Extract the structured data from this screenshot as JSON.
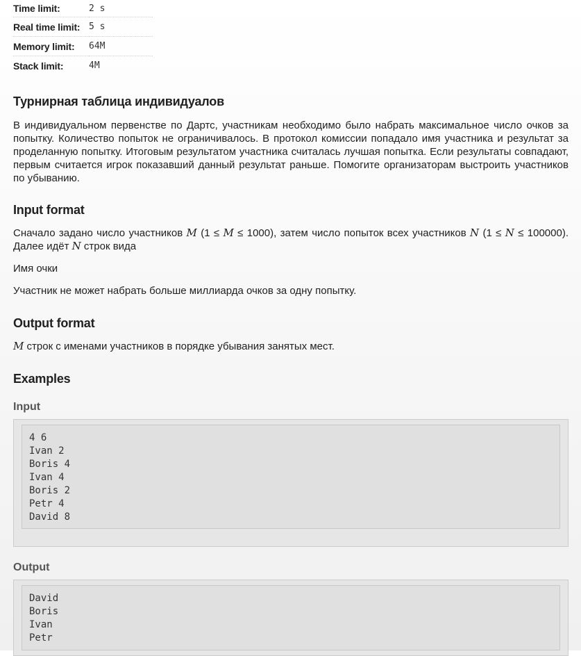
{
  "limits": [
    {
      "label": "Time limit:",
      "value": "2 s"
    },
    {
      "label": "Real time limit:",
      "value": "5 s"
    },
    {
      "label": "Memory limit:",
      "value": "64M"
    },
    {
      "label": "Stack limit:",
      "value": "4M"
    }
  ],
  "problem": {
    "title": "Турнирная таблица индивидуалов",
    "statement": "В индивидуальном первенстве по Дартс, участникам необходимо было набрать максимальное число очков за попытку. Количество попыток не ограничивалось. В протокол комиссии попадало имя участника и результат за проделанную попытку. Итоговым результатом участника считалась лучшая попытка. Если результаты совпадают, первым считается игрок показавший данный результат раньше. Помогите организаторам выстроить участников по убыванию."
  },
  "input_format": {
    "heading": "Input format",
    "p1_a": "Сначало задано число участников ",
    "p1_var_m": "M",
    "p1_b": " (1 ≤ ",
    "p1_var_m2": "M",
    "p1_c": " ≤ 1000), затем число попыток всех участников ",
    "p1_var_n": "N",
    "p1_d": " (1 ≤ ",
    "p1_var_n2": "N",
    "p1_e": " ≤ 100000). Далее идёт ",
    "p1_var_n3": "N",
    "p1_f": " строк вида",
    "p2": "Имя очки",
    "p3": "Участник не может набрать больше миллиарда очков за одну попытку."
  },
  "output_format": {
    "heading": "Output format",
    "var_m": "M",
    "text": " строк с именами участников в порядке убывания занятых мест."
  },
  "examples": {
    "heading": "Examples",
    "input_label": "Input",
    "input_text": "4 6\nIvan 2\nBoris 4\nIvan 4\nBoris 2\nPetr 4\nDavid 8",
    "output_label": "Output",
    "output_text": "David\nBoris\nIvan\nPetr"
  }
}
